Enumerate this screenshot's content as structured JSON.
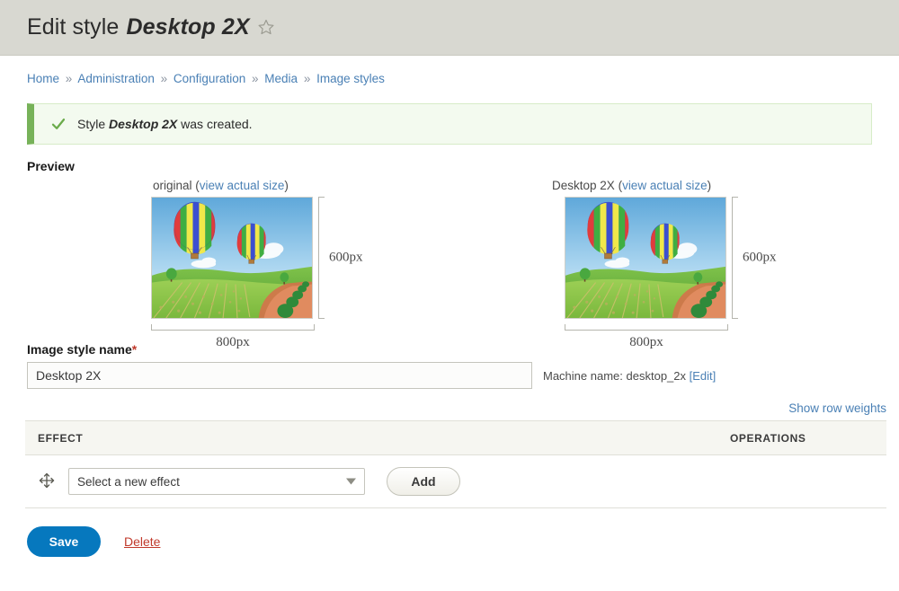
{
  "header": {
    "title_prefix": "Edit style",
    "style_name": "Desktop 2X",
    "star_icon": "star-outline-icon"
  },
  "breadcrumb": {
    "separator": "»",
    "items": [
      {
        "label": "Home"
      },
      {
        "label": "Administration"
      },
      {
        "label": "Configuration"
      },
      {
        "label": "Media"
      },
      {
        "label": "Image styles"
      }
    ]
  },
  "status": {
    "icon": "check-icon",
    "prefix": "Style",
    "emphasis": "Desktop 2X",
    "suffix": "was created.",
    "border_color": "#77b259",
    "background_color": "#f3faef"
  },
  "preview": {
    "section_label": "Preview",
    "view_actual_size_label": "view actual size",
    "images": [
      {
        "title": "original",
        "caption_open": "(",
        "caption_close": ")",
        "width_label": "800px",
        "height_label": "600px",
        "alt": "hot air balloons over a vineyard landscape"
      },
      {
        "title": "Desktop 2X",
        "caption_open": "(",
        "caption_close": ")",
        "width_label": "800px",
        "height_label": "600px",
        "alt": "hot air balloons over a vineyard landscape"
      }
    ]
  },
  "form": {
    "name_label": "Image style name",
    "required_marker": "*",
    "name_value": "Desktop 2X",
    "name_placeholder": "",
    "machine_name_prefix": "Machine name:",
    "machine_name_value": "desktop_2x",
    "machine_name_edit": "[Edit]"
  },
  "table": {
    "show_row_weights": "Show row weights",
    "columns": [
      "EFFECT",
      "OPERATIONS"
    ],
    "rows": [
      {
        "drag_handle_icon": "drag-move-icon",
        "select_value": "Select a new effect",
        "add_label": "Add"
      }
    ]
  },
  "actions": {
    "save_label": "Save",
    "delete_label": "Delete",
    "save_color": "#0678be",
    "delete_color": "#c0392b"
  }
}
